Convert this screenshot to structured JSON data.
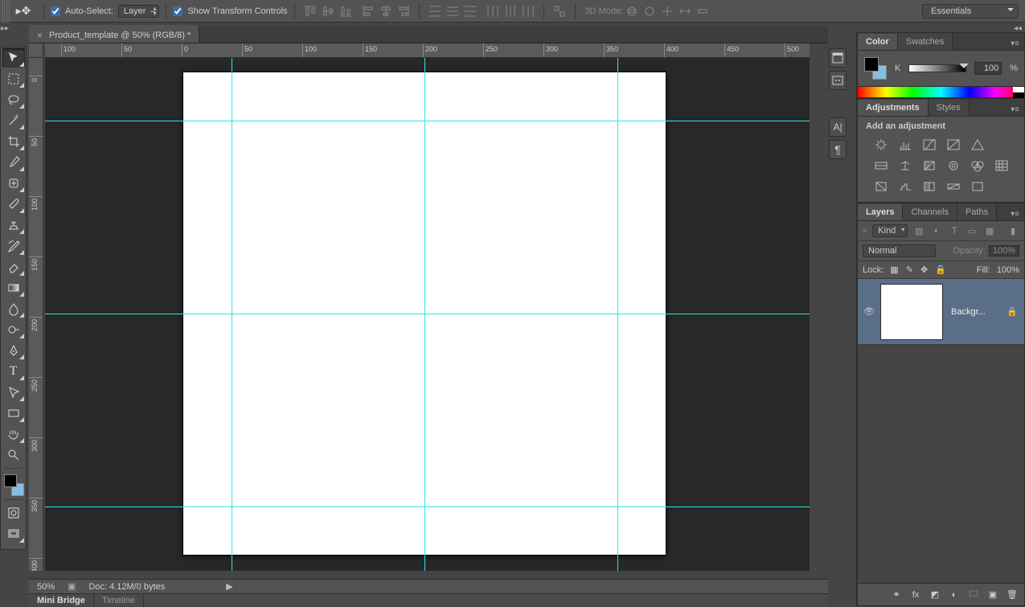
{
  "optionsBar": {
    "autoSelectLabel": "Auto-Select:",
    "autoSelectTarget": "Layer",
    "showTransformLabel": "Show Transform Controls",
    "threeDModeLabel": "3D Mode:"
  },
  "workspaceSelector": "Essentials",
  "documentTab": {
    "title": "Product_template @ 50% (RGB/8) *"
  },
  "rulerH": [
    "100",
    "50",
    "0",
    "50",
    "100",
    "150",
    "200",
    "250",
    "300",
    "350",
    "400",
    "450",
    "500"
  ],
  "rulerV": [
    "0",
    "50",
    "100",
    "150",
    "200",
    "250",
    "300",
    "350",
    "400"
  ],
  "status": {
    "zoom": "50%",
    "docInfo": "Doc: 4.12M/0 bytes"
  },
  "bottomTabs": {
    "miniBridge": "Mini Bridge",
    "timeline": "Timeline"
  },
  "panels": {
    "color": {
      "tabs": [
        "Color",
        "Swatches"
      ],
      "channelLabel": "K",
      "value": "100",
      "unit": "%"
    },
    "adjustments": {
      "tabs": [
        "Adjustments",
        "Styles"
      ],
      "heading": "Add an adjustment"
    },
    "layers": {
      "tabs": [
        "Layers",
        "Channels",
        "Paths"
      ],
      "kindLabel": "Kind",
      "blendMode": "Normal",
      "opacityLabel": "Opacity:",
      "opacityValue": "100%",
      "lockLabel": "Lock:",
      "fillLabel": "Fill:",
      "fillValue": "100%",
      "items": [
        {
          "name": "Backgr...",
          "locked": true
        }
      ]
    }
  }
}
